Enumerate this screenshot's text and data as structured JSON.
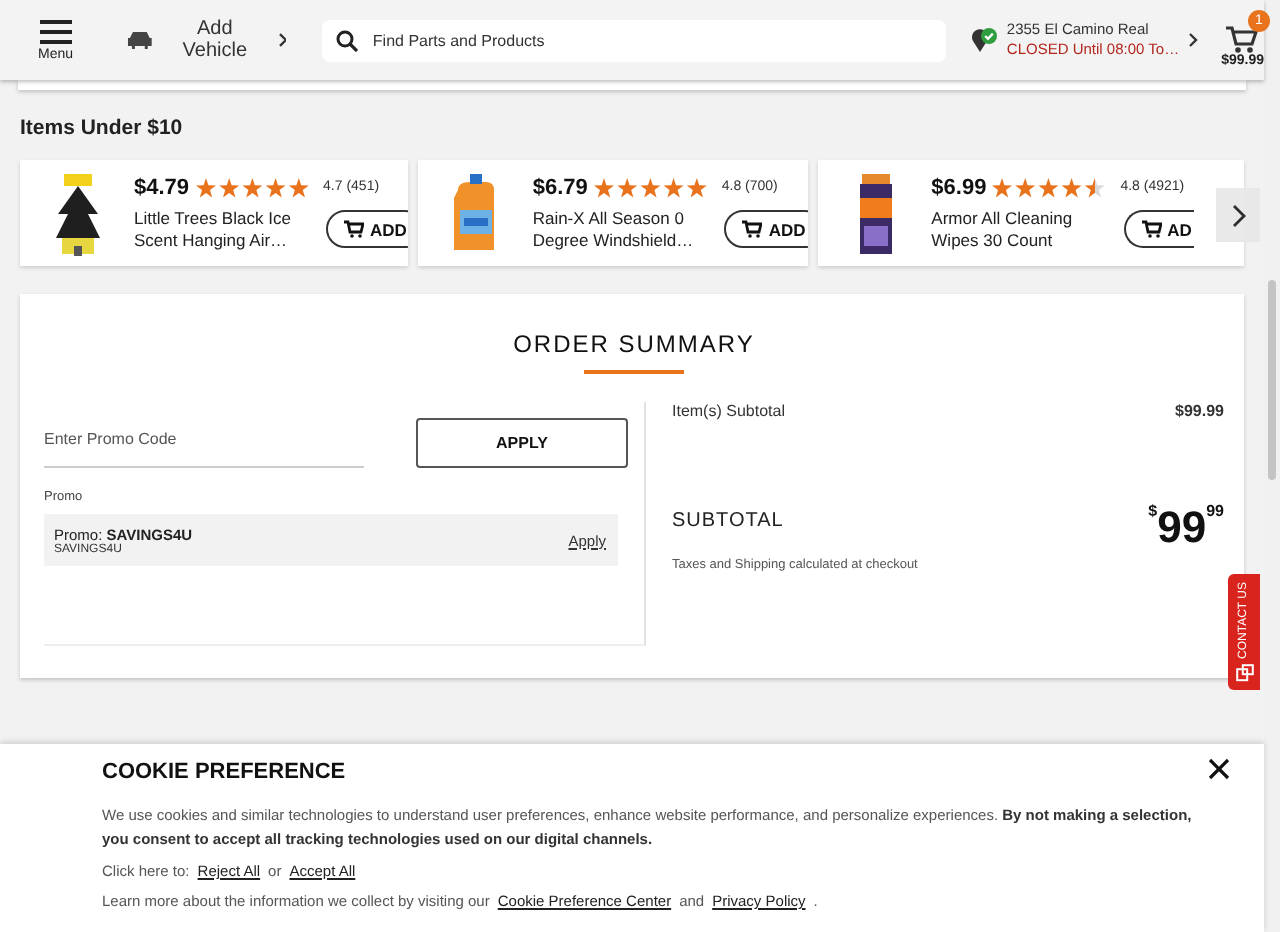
{
  "header": {
    "menu_label": "Menu",
    "vehicle": "Add Vehicle",
    "search_placeholder": "Find Parts and Products",
    "store": {
      "address": "2355 El Camino Real",
      "status": "CLOSED Until 08:00 To…"
    },
    "cart": {
      "count": "1",
      "total": "$99.99"
    }
  },
  "carousel": {
    "title": "Items Under $10",
    "products": [
      {
        "price": "$4.79",
        "stars": 5,
        "rating": "4.7 (451)",
        "name": "Little Trees Black Ice Scent Hanging Air…",
        "button": "ADD"
      },
      {
        "price": "$6.79",
        "stars": 5,
        "rating": "4.8 (700)",
        "name": "Rain-X All Season 0 Degree Windshield…",
        "button": "ADD"
      },
      {
        "price": "$6.99",
        "stars": 4.5,
        "rating": "4.8 (4921)",
        "name": "Armor All Cleaning Wipes 30 Count",
        "button": "AD"
      }
    ]
  },
  "order_summary": {
    "title": "ORDER SUMMARY",
    "promo_placeholder": "Enter Promo Code",
    "apply_button": "APPLY",
    "promo_label": "Promo",
    "promo": {
      "title": "Promo: **SAVINGS4U**",
      "code": "SAVINGS4U",
      "action": "Apply"
    },
    "items_label": "Item(s) Subtotal",
    "items_value": "$99.99",
    "subtotal_label": "SUBTOTAL",
    "subtotal_currency": "$",
    "subtotal_whole": "99",
    "subtotal_cents": "99",
    "note": "Taxes and Shipping calculated at checkout"
  },
  "contact_tab": "CONTACT US",
  "cookie": {
    "title": "COOKIE PREFERENCE",
    "text": "We use cookies and similar technologies to understand user preferences, enhance website performance, and personalize experiences. **By not making a selection, you consent to accept all tracking technologies used on our digital channels.**",
    "choice": [
      {
        "kind": "text",
        "text": "Click here to:"
      },
      {
        "kind": "link",
        "text": "Reject All"
      },
      {
        "kind": "text",
        "text": "or"
      },
      {
        "kind": "link",
        "text": "Accept All"
      }
    ],
    "learn": [
      {
        "kind": "text",
        "text": "Learn more about the information we collect by visiting our"
      },
      {
        "kind": "link",
        "text": "Cookie Preference Center"
      },
      {
        "kind": "text",
        "text": "and"
      },
      {
        "kind": "link",
        "text": "Privacy Policy"
      },
      {
        "kind": "text",
        "text": "."
      }
    ]
  }
}
